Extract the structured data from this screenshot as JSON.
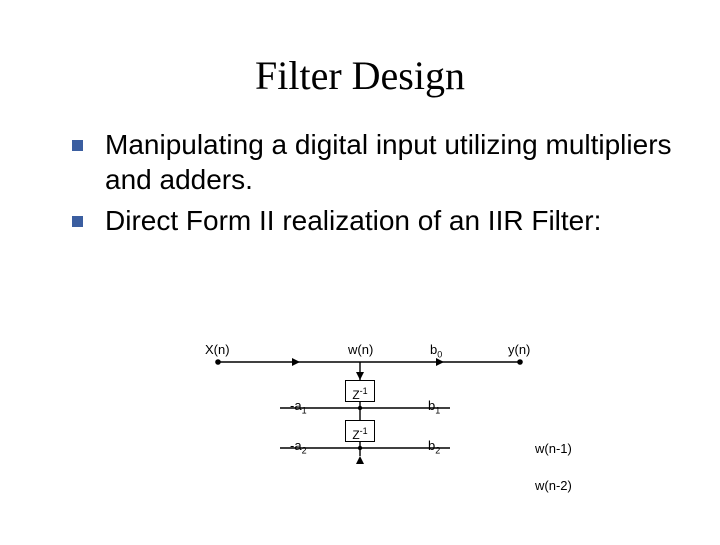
{
  "title": "Filter Design",
  "bullets": [
    "Manipulating a digital input utilizing multipliers and adders.",
    "Direct Form II realization of an IIR Filter:"
  ],
  "diagram": {
    "xn": "X(n)",
    "wn": "w(n)",
    "yn": "y(n)",
    "b0": "b",
    "b0_sub": "0",
    "b1": "b",
    "b1_sub": "1",
    "b2": "b",
    "b2_sub": "2",
    "neg_a1": "-a",
    "a1_sub": "1",
    "neg_a2": "-a",
    "a2_sub": "2",
    "z": "Z",
    "z_sup": "-1",
    "wn1": "w(n-1)",
    "wn2": "w(n-2)"
  }
}
